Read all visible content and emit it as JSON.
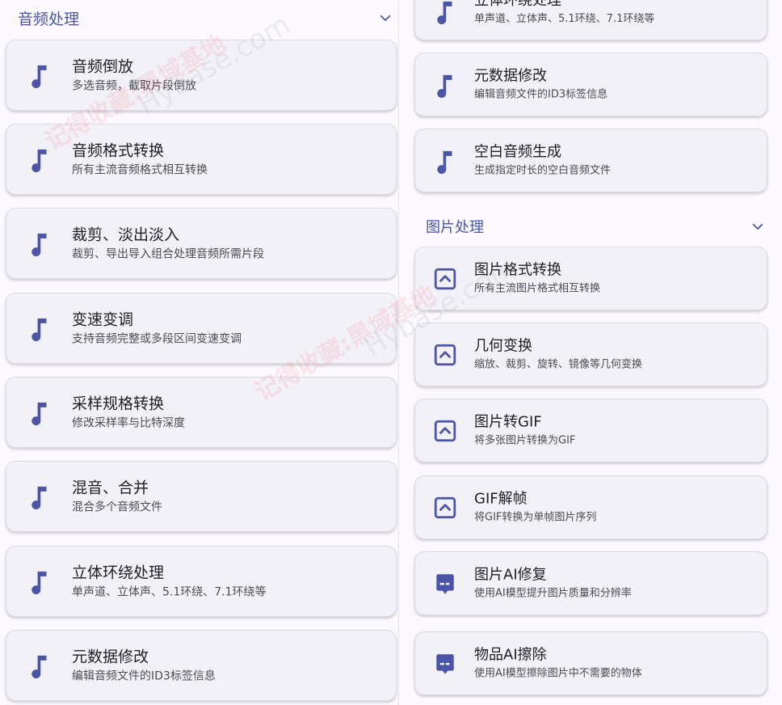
{
  "left": {
    "section_title": "音频处理",
    "cards": [
      {
        "title": "音频倒放",
        "sub": "多选音频，截取片段倒放",
        "icon": "music-note-icon"
      },
      {
        "title": "音频格式转换",
        "sub": "所有主流音频格式相互转换",
        "icon": "music-note-icon"
      },
      {
        "title": "裁剪、淡出淡入",
        "sub": "裁剪、导出导入组合处理音频所需片段",
        "icon": "music-note-icon"
      },
      {
        "title": "变速变调",
        "sub": "支持音频完整或多段区间变速变调",
        "icon": "music-note-icon"
      },
      {
        "title": "采样规格转换",
        "sub": "修改采样率与比特深度",
        "icon": "music-note-icon"
      },
      {
        "title": "混音、合并",
        "sub": "混合多个音频文件",
        "icon": "music-note-icon"
      },
      {
        "title": "立体环绕处理",
        "sub": "单声道、立体声、5.1环绕、7.1环绕等",
        "icon": "music-note-icon"
      },
      {
        "title": "元数据修改",
        "sub": "编辑音频文件的ID3标签信息",
        "icon": "music-note-icon"
      }
    ]
  },
  "right": {
    "top_cards": [
      {
        "title": "立体环绕处理",
        "sub": "单声道、立体声、5.1环绕、7.1环绕等",
        "icon": "music-note-icon"
      },
      {
        "title": "元数据修改",
        "sub": "编辑音频文件的ID3标签信息",
        "icon": "music-note-icon"
      },
      {
        "title": "空白音频生成",
        "sub": "生成指定时长的空白音频文件",
        "icon": "music-note-icon"
      }
    ],
    "section_title": "图片处理",
    "cards": [
      {
        "title": "图片格式转换",
        "sub": "所有主流图片格式相互转换",
        "icon": "image-icon"
      },
      {
        "title": "几何变换",
        "sub": "缩放、裁剪、旋转、镜像等几何变换",
        "icon": "image-icon"
      },
      {
        "title": "图片转GIF",
        "sub": "将多张图片转换为GIF",
        "icon": "image-icon"
      },
      {
        "title": "GIF解帧",
        "sub": "将GIF转换为单帧图片序列",
        "icon": "image-icon"
      },
      {
        "title": "图片AI修复",
        "sub": "使用AI模型提升图片质量和分辨率",
        "icon": "ai-chat-icon"
      },
      {
        "title": "物品AI擦除",
        "sub": "使用AI模型擦除图片中不需要的物体",
        "icon": "ai-chat-icon"
      }
    ]
  },
  "watermark": {
    "cn": "记得收藏:黑域基地",
    "en": "Hybase.com"
  },
  "colors": {
    "accent": "#4a55a8",
    "card_bg": "#f3f1f8",
    "page_bg": "#fbf9fe"
  }
}
